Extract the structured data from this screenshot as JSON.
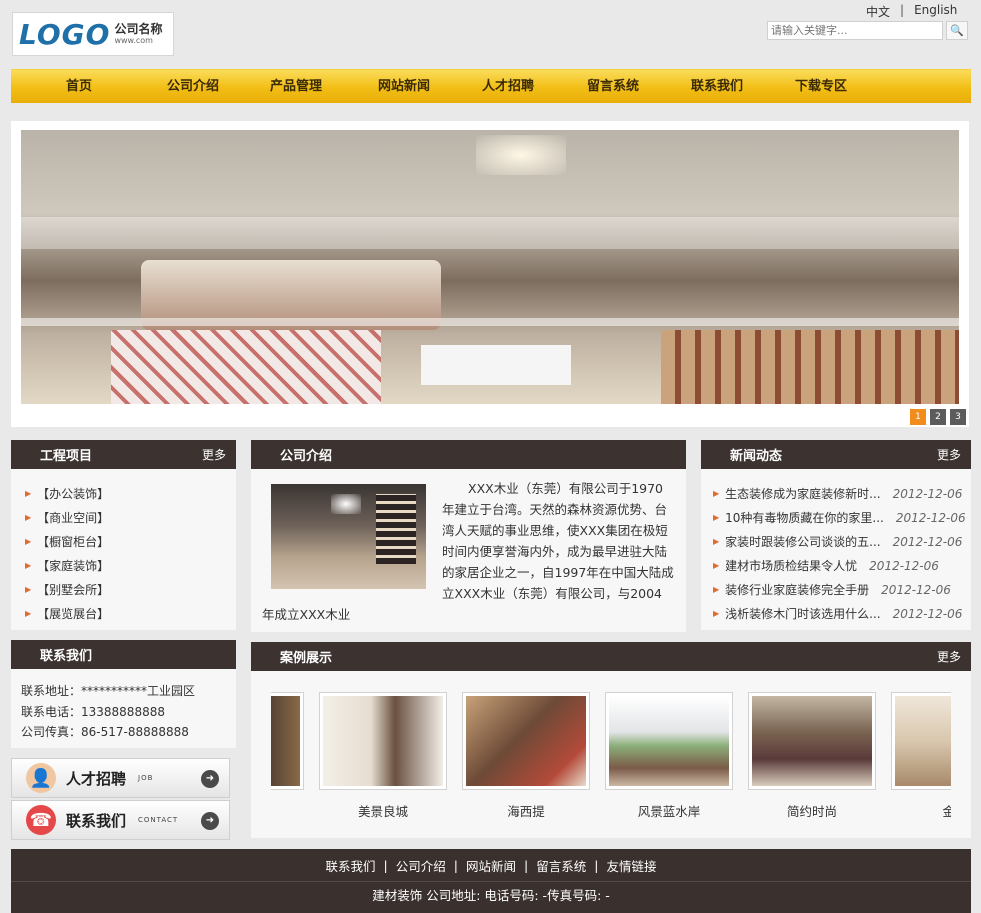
{
  "header": {
    "logo_text": "LOGO",
    "logo_company": "公司名称",
    "logo_url": "www.com",
    "lang_cn": "中文",
    "lang_sep": "|",
    "lang_en": "English",
    "search_placeholder": "请输入关键字..."
  },
  "nav": {
    "items": [
      "首页",
      "公司介绍",
      "产品管理",
      "网站新闻",
      "人才招聘",
      "留言系统",
      "联系我们",
      "下载专区"
    ]
  },
  "banner": {
    "slides": [
      "1",
      "2",
      "3"
    ],
    "active_slide": 1
  },
  "projects": {
    "title": "工程项目",
    "more": "更多",
    "items": [
      "【办公装饰】",
      "【商业空间】",
      "【橱窗柜台】",
      "【家庭装饰】",
      "【别墅会所】",
      "【展览展台】"
    ]
  },
  "contact": {
    "title": "联系我们",
    "address": "联系地址：***********工业园区",
    "phone": "联系电话：13388888888",
    "fax": "公司传真：86-517-88888888"
  },
  "tiles": {
    "jobs_label": "人才招聘",
    "jobs_sub": "JOB",
    "contact_label": "联系我们",
    "contact_sub": "CONTACT"
  },
  "about": {
    "title": "公司介绍",
    "text": "XXX木业（东莞）有限公司于1970年建立于台湾。天然的森林资源优势、台湾人天赋的事业思维，使XXX集团在极短时间内便享誉海内外，成为最早进驻大陆的家居企业之一，自1997年在中国大陆成立XXX木业（东莞）有限公司，与2004年成立XXX木业"
  },
  "news": {
    "title": "新闻动态",
    "more": "更多",
    "items": [
      {
        "title": "生态装修成为家庭装修新时...",
        "date": "2012-12-06"
      },
      {
        "title": "10种有毒物质藏在你的家里...",
        "date": "2012-12-06"
      },
      {
        "title": "家装时跟装修公司谈谈的五...",
        "date": "2012-12-06"
      },
      {
        "title": "建材市场质检结果令人忧",
        "date": "2012-12-06"
      },
      {
        "title": "装修行业家庭装修完全手册",
        "date": "2012-12-06"
      },
      {
        "title": "浅析装修木门时该选用什么...",
        "date": "2012-12-06"
      }
    ]
  },
  "cases": {
    "title": "案例展示",
    "more": "更多",
    "items": [
      {
        "caption": ""
      },
      {
        "caption": "美景良城"
      },
      {
        "caption": "海西提"
      },
      {
        "caption": "风景蓝水岸"
      },
      {
        "caption": "简约时尚"
      },
      {
        "caption": "金辉"
      }
    ]
  },
  "footer": {
    "links": [
      "联系我们",
      "公司介绍",
      "网站新闻",
      "留言系统",
      "友情链接"
    ],
    "link_sep": "|",
    "info": "建材装饰 公司地址: 电话号码: -传真号码: -"
  },
  "colors": {
    "nav_yellow": "#f2be15",
    "box_header": "#3c3230",
    "bullet": "#e46a2a",
    "active_dot": "#f28c1c",
    "footer": "#3a302e"
  }
}
